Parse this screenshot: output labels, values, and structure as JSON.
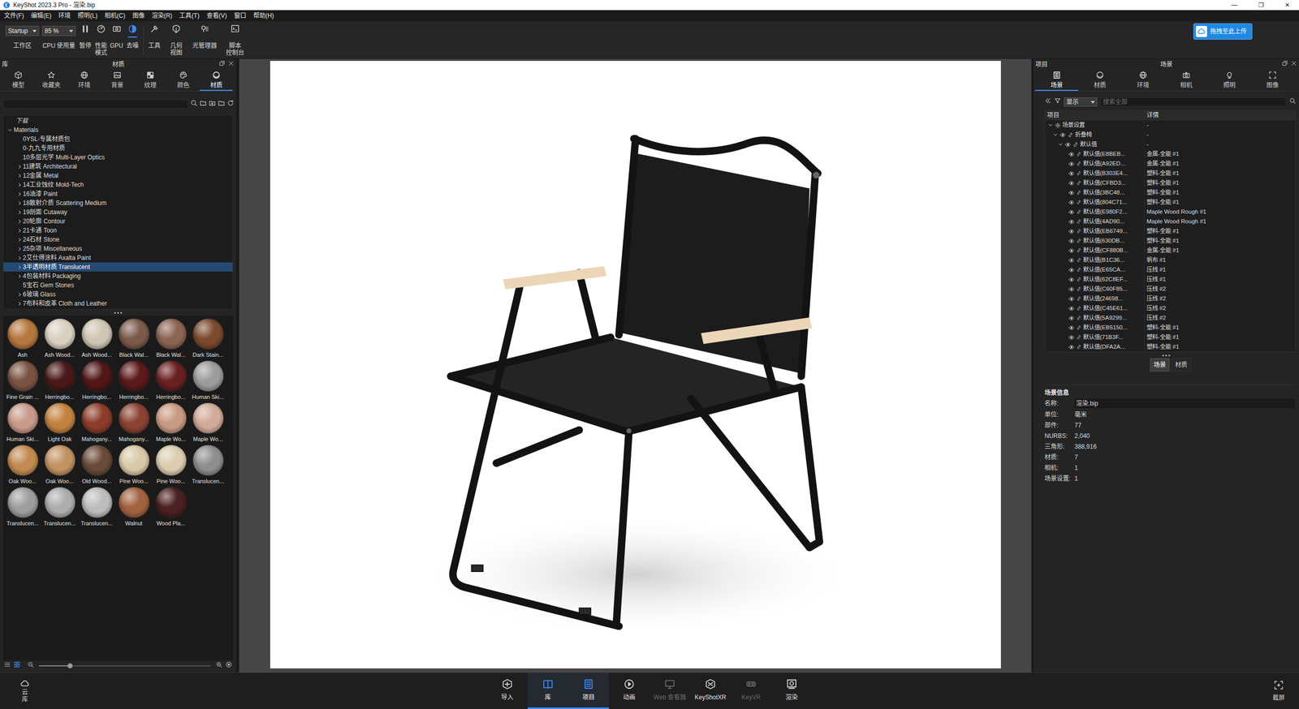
{
  "window": {
    "title": "KeyShot 2023.3 Pro  - 渲染.bip",
    "controls": [
      "—",
      "❐",
      "✕"
    ]
  },
  "menu": [
    "文件(F)",
    "编辑(E)",
    "环境",
    "照明(L)",
    "相机(C)",
    "图像",
    "渲染(R)",
    "工具(T)",
    "查看(V)",
    "窗口",
    "帮助(H)"
  ],
  "toolbar": {
    "groups": [
      {
        "items": [
          {
            "kind": "dropdown",
            "value": "Startup",
            "label": "工作区"
          },
          {
            "kind": "dropdown",
            "value": "85 %",
            "label": "CPU 使用量"
          },
          {
            "kind": "toggle",
            "label": "暂停",
            "selected": false
          },
          {
            "kind": "toggle",
            "label": "性能\n模式",
            "selected": false
          },
          {
            "kind": "toggle",
            "label": "GPU",
            "selected": false
          },
          {
            "kind": "toggle",
            "label": "去噪",
            "selected": true
          }
        ]
      },
      {
        "items": [
          {
            "kind": "toggle",
            "label": "工具",
            "selected": false
          },
          {
            "kind": "toggle",
            "label": "几何\n视图",
            "selected": false
          },
          {
            "kind": "toggle",
            "label": "光管理器",
            "selected": false
          },
          {
            "kind": "toggle",
            "label": "脚本\n控制台",
            "selected": false
          }
        ]
      }
    ]
  },
  "upload": {
    "label": "拖拽至此上传"
  },
  "library": {
    "title": "库",
    "heading": "材质",
    "tabs": [
      {
        "label": "模型",
        "selected": false
      },
      {
        "label": "收藏夹",
        "selected": false
      },
      {
        "label": "环境",
        "selected": false
      },
      {
        "label": "背景",
        "selected": false
      },
      {
        "label": "纹理",
        "selected": false
      },
      {
        "label": "颜色",
        "selected": false
      },
      {
        "label": "材质",
        "selected": true
      }
    ],
    "tree": {
      "heading": "下载",
      "root": {
        "label": "Materials",
        "expanded": true
      },
      "items": [
        {
          "label": "0YSL-专属材质包",
          "expandable": false,
          "selected": false
        },
        {
          "label": "0-九九专用材质",
          "expandable": false,
          "selected": false
        },
        {
          "label": "10多层光学 Multi-Layer Optics",
          "expandable": false,
          "selected": false
        },
        {
          "label": "11建筑 Architectural",
          "expandable": true,
          "selected": false
        },
        {
          "label": "12金属 Metal",
          "expandable": true,
          "selected": false
        },
        {
          "label": "14工业蚀纹 Mold-Tech",
          "expandable": true,
          "selected": false
        },
        {
          "label": "16油漆 Paint",
          "expandable": true,
          "selected": false
        },
        {
          "label": "18散射介质 Scattering Medium",
          "expandable": true,
          "selected": false
        },
        {
          "label": "19剖面 Cutaway",
          "expandable": true,
          "selected": false
        },
        {
          "label": "20轮廓 Contour",
          "expandable": true,
          "selected": false
        },
        {
          "label": "21卡通 Toon",
          "expandable": true,
          "selected": false
        },
        {
          "label": "24石材 Stone",
          "expandable": true,
          "selected": false
        },
        {
          "label": "25杂项 Miscellaneous",
          "expandable": true,
          "selected": false
        },
        {
          "label": "2艾仕得涂料 Axalta Paint",
          "expandable": true,
          "selected": false
        },
        {
          "label": "3半透明材质 Translucent",
          "expandable": true,
          "selected": true
        },
        {
          "label": "4包装材料 Packaging",
          "expandable": true,
          "selected": false
        },
        {
          "label": "5宝石 Gem Stones",
          "expandable": false,
          "selected": false
        },
        {
          "label": "6玻璃 Glass",
          "expandable": true,
          "selected": false
        },
        {
          "label": "7布料和皮革 Cloth and Leather",
          "expandable": true,
          "selected": false
        }
      ]
    },
    "thumbnails": [
      {
        "label": "Ash",
        "color": "#b5773d"
      },
      {
        "label": "Ash Wood...",
        "color": "#d9d0c0"
      },
      {
        "label": "Ash Wood...",
        "color": "#cfc5b3"
      },
      {
        "label": "Black Wal...",
        "color": "#7c5a4a"
      },
      {
        "label": "Black Wal...",
        "color": "#8c6452"
      },
      {
        "label": "Dark Stain...",
        "color": "#7a4a2c"
      },
      {
        "label": "Fine Grain ...",
        "color": "#7a5242"
      },
      {
        "label": "Herringbo...",
        "color": "#4a1818"
      },
      {
        "label": "Herringbo...",
        "color": "#521616"
      },
      {
        "label": "Herringbo...",
        "color": "#5c1a1a"
      },
      {
        "label": "Herringbo...",
        "color": "#6a2020"
      },
      {
        "label": "Human Ski...",
        "color": "#9c9c9c"
      },
      {
        "label": "Human Ski...",
        "color": "#c99a8a"
      },
      {
        "label": "Light Oak",
        "color": "#c2823f"
      },
      {
        "label": "Mahogany...",
        "color": "#8c3c28"
      },
      {
        "label": "Mahogany...",
        "color": "#8a4232"
      },
      {
        "label": "Maple Wo...",
        "color": "#c99a82"
      },
      {
        "label": "Maple Wo...",
        "color": "#d2aa9a"
      },
      {
        "label": "Oak Woo...",
        "color": "#c28a50"
      },
      {
        "label": "Oak Woo...",
        "color": "#c39262"
      },
      {
        "label": "Old Wood...",
        "color": "#6a4a38"
      },
      {
        "label": "Pine Woo...",
        "color": "#d9c9a8"
      },
      {
        "label": "Pine Woo...",
        "color": "#dccdb0"
      },
      {
        "label": "Translucen...",
        "color": "#8e8e8e"
      },
      {
        "label": "Translucen...",
        "color": "#9e9e9e"
      },
      {
        "label": "Translucen...",
        "color": "#adadad"
      },
      {
        "label": "Translucen...",
        "color": "#bdbdbd"
      },
      {
        "label": "Walnut",
        "color": "#a2623f"
      },
      {
        "label": "Wood Pla...",
        "color": "#4c2020"
      }
    ],
    "view_modes": [
      {
        "kind": "list",
        "selected": false
      },
      {
        "kind": "grid",
        "selected": true
      }
    ],
    "thumb_size": {
      "level": 0.18
    }
  },
  "scene": {
    "title": "项目",
    "heading": "场景",
    "tabs": [
      {
        "label": "场景",
        "selected": true
      },
      {
        "label": "材质",
        "selected": false
      },
      {
        "label": "环境",
        "selected": false
      },
      {
        "label": "相机",
        "selected": false
      },
      {
        "label": "照明",
        "selected": false
      },
      {
        "label": "图像",
        "selected": false
      }
    ],
    "filter": {
      "value": "显示"
    },
    "search": {
      "placeholder": "搜索全部"
    },
    "columns": [
      "项目",
      "详情"
    ],
    "tree": {
      "settings": {
        "label": "场景设置",
        "detail": "-",
        "expanded": true
      },
      "model": {
        "label": "折叠椅",
        "detail": "-",
        "expanded": true,
        "visible": true
      },
      "group": {
        "label": "默认值",
        "detail": "-",
        "expanded": true,
        "visible": true
      },
      "parts": [
        {
          "label": "默认值(E8BEB...",
          "detail": "金属-全能 #1",
          "visible": true
        },
        {
          "label": "默认值(A92ED...",
          "detail": "金属-全能 #1",
          "visible": true
        },
        {
          "label": "默认值(B303E4...",
          "detail": "塑料-全能 #1",
          "visible": true
        },
        {
          "label": "默认值(CFBD3...",
          "detail": "塑料-全能 #1",
          "visible": true
        },
        {
          "label": "默认值(3BC48...",
          "detail": "塑料-全能 #1",
          "visible": true
        },
        {
          "label": "默认值(804C71...",
          "detail": "塑料-全能 #1",
          "visible": true
        },
        {
          "label": "默认值(E980F2...",
          "detail": "Maple Wood Rough #1",
          "visible": true
        },
        {
          "label": "默认值(4AD90...",
          "detail": "Maple Wood Rough #1",
          "visible": true
        },
        {
          "label": "默认值(EB6749...",
          "detail": "塑料-全能 #1",
          "visible": true
        },
        {
          "label": "默认值(630DB...",
          "detail": "塑料-全能 #1",
          "visible": true
        },
        {
          "label": "默认值(CF880B...",
          "detail": "金属-全能 #1",
          "visible": true
        },
        {
          "label": "默认值(B1C36...",
          "detail": "帆布 #1",
          "visible": true
        },
        {
          "label": "默认值(E65CA...",
          "detail": "压线 #1",
          "visible": true
        },
        {
          "label": "默认值(62C8EF...",
          "detail": "压线 #1",
          "visible": true
        },
        {
          "label": "默认值(C60F85...",
          "detail": "压线 #2",
          "visible": true
        },
        {
          "label": "默认值(24698...",
          "detail": "压线 #2",
          "visible": true
        },
        {
          "label": "默认值(C45E61...",
          "detail": "压线 #2",
          "visible": true
        },
        {
          "label": "默认值(5A9299...",
          "detail": "压线 #2",
          "visible": true
        },
        {
          "label": "默认值(EB5150...",
          "detail": "塑料-全能 #1",
          "visible": true
        },
        {
          "label": "默认值(71B3F...",
          "detail": "塑料-全能 #1",
          "visible": true
        },
        {
          "label": "默认值(DFA2A...",
          "detail": "塑料-全能 #1",
          "visible": true
        }
      ]
    },
    "switch": [
      {
        "label": "场景",
        "selected": true
      },
      {
        "label": "材质",
        "selected": false
      }
    ],
    "info": {
      "title": "场景信息",
      "rows": [
        {
          "key": "名称:",
          "value": "渲染.bip"
        },
        {
          "key": "单位:",
          "value": "毫米"
        },
        {
          "key": "部件:",
          "value": "77"
        },
        {
          "key": "NURBS:",
          "value": "2,040"
        },
        {
          "key": "三角形:",
          "value": "388,916"
        },
        {
          "key": "材质:",
          "value": "7"
        },
        {
          "key": "相机:",
          "value": "1"
        },
        {
          "key": "场景设置:",
          "value": "1"
        }
      ]
    }
  },
  "dock": {
    "cloud": {
      "label": "云库"
    },
    "items": [
      {
        "label": "导入",
        "selected": false,
        "disabled": false
      },
      {
        "label": "库",
        "selected": true,
        "disabled": false
      },
      {
        "label": "项目",
        "selected": true,
        "disabled": false
      },
      {
        "label": "动画",
        "selected": false,
        "disabled": false
      },
      {
        "label": "Web 查看器",
        "selected": false,
        "disabled": true
      },
      {
        "label": "KeyShotXR",
        "selected": false,
        "disabled": false
      },
      {
        "label": "KeyVR",
        "selected": false,
        "disabled": true
      },
      {
        "label": "渲染",
        "selected": false,
        "disabled": false
      }
    ],
    "screenshot": {
      "label": "截屏"
    }
  }
}
